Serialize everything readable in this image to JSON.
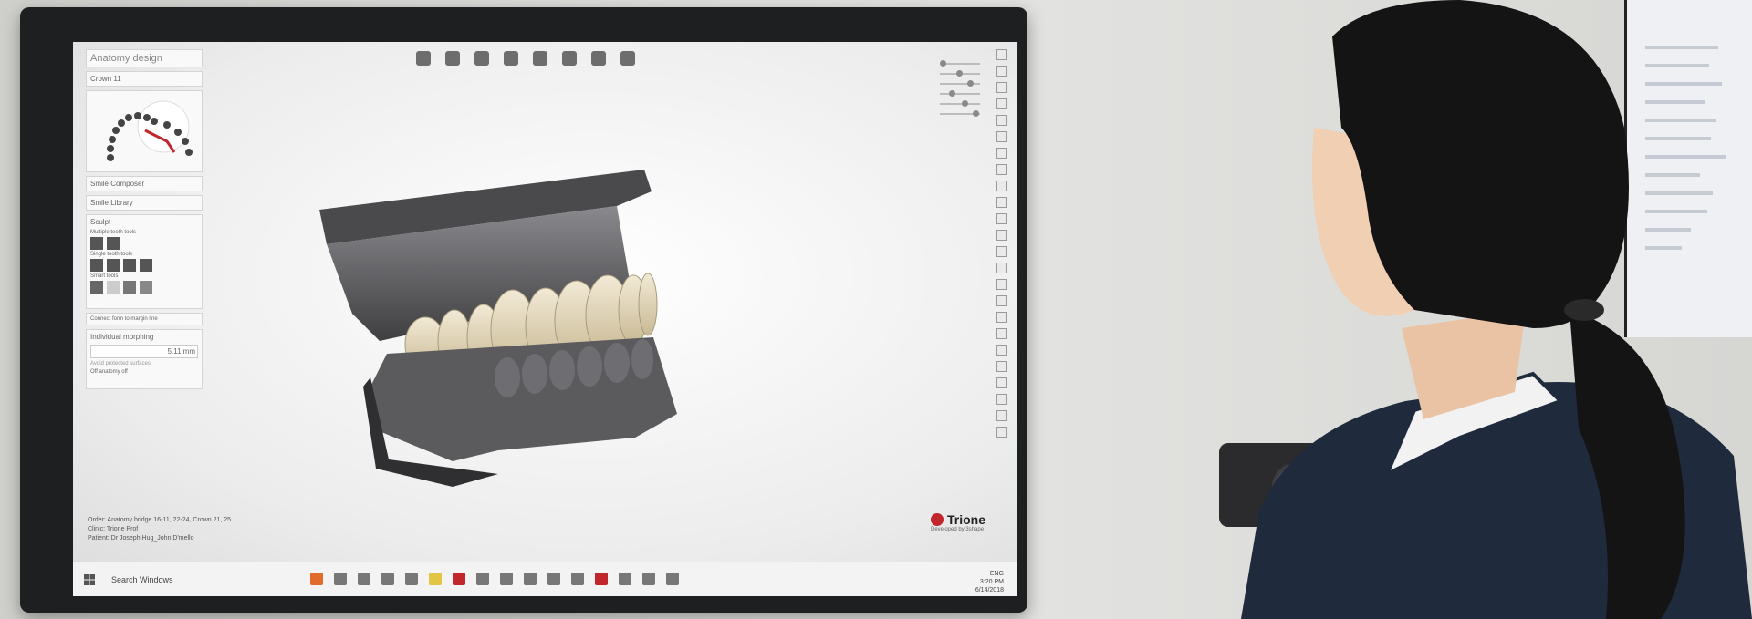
{
  "app": {
    "panel": {
      "anatomy_design": "Anatomy design",
      "crown": "Crown 11",
      "smile_composer": "Smile Composer",
      "smile_library": "Smile Library",
      "sculpt": "Sculpt",
      "multiple_teeth_tools": "Multiple teeth tools",
      "single_tooth_tools": "Single tooth tools",
      "smart_tools": "Smart tools",
      "connect_margin": "Connect form to margin line",
      "individual_morphing": "Individual morphing",
      "distance_value": "5.11 mm",
      "protected_surfaces": "Avoid protected surfaces",
      "anatomy_off": "Off anatomy off"
    },
    "case_info": {
      "order": "Order:     Anatomy bridge 16-11, 22-24, Crown 21, 25",
      "clinic": "Clinic:     Trione Prof",
      "patient": "Patient:   Dr Joseph Hug_John D'mello"
    },
    "brand": {
      "name": "Trione",
      "sub": "Developed by 3shape"
    },
    "taskbar": {
      "search": "Search Windows",
      "time": "3:20 PM",
      "date": "6/14/2018",
      "lang": "ENG"
    }
  },
  "colors": {
    "brand_red": "#c0262c",
    "tooth_crown": "#e8dcc2",
    "model_gray": "#5b5b5e",
    "monitor_bezel": "#1e1f21",
    "uniform_navy": "#1f2a3d",
    "hair": "#151414"
  }
}
